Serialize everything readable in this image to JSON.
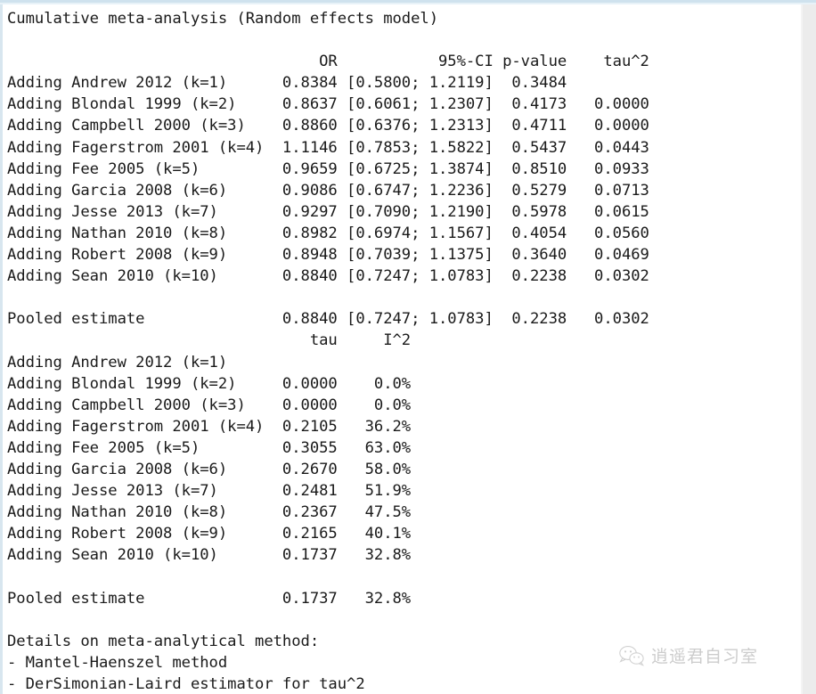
{
  "window": {
    "title": "Cumulative meta-analysis (Random effects model)",
    "accent_border_color": "#cfe2ee",
    "text_color": "#1a1a1a",
    "background_color": "#ffffff"
  },
  "table1": {
    "headers": [
      "",
      "OR",
      "95%-CI",
      "p-value",
      "tau^2"
    ],
    "rows": [
      {
        "label": "Adding Andrew 2012 (k=1)",
        "or": "0.8384",
        "ci": "[0.5800; 1.2119]",
        "p": "0.3484",
        "tau2": ""
      },
      {
        "label": "Adding Blondal 1999 (k=2)",
        "or": "0.8637",
        "ci": "[0.6061; 1.2307]",
        "p": "0.4173",
        "tau2": "0.0000"
      },
      {
        "label": "Adding Campbell 2000 (k=3)",
        "or": "0.8860",
        "ci": "[0.6376; 1.2313]",
        "p": "0.4711",
        "tau2": "0.0000"
      },
      {
        "label": "Adding Fagerstrom 2001 (k=4)",
        "or": "1.1146",
        "ci": "[0.7853; 1.5822]",
        "p": "0.5437",
        "tau2": "0.0443"
      },
      {
        "label": "Adding Fee 2005 (k=5)",
        "or": "0.9659",
        "ci": "[0.6725; 1.3874]",
        "p": "0.8510",
        "tau2": "0.0933"
      },
      {
        "label": "Adding Garcia 2008 (k=6)",
        "or": "0.9086",
        "ci": "[0.6747; 1.2236]",
        "p": "0.5279",
        "tau2": "0.0713"
      },
      {
        "label": "Adding Jesse 2013 (k=7)",
        "or": "0.9297",
        "ci": "[0.7090; 1.2190]",
        "p": "0.5978",
        "tau2": "0.0615"
      },
      {
        "label": "Adding Nathan 2010 (k=8)",
        "or": "0.8982",
        "ci": "[0.6974; 1.1567]",
        "p": "0.4054",
        "tau2": "0.0560"
      },
      {
        "label": "Adding Robert 2008 (k=9)",
        "or": "0.8948",
        "ci": "[0.7039; 1.1375]",
        "p": "0.3640",
        "tau2": "0.0469"
      },
      {
        "label": "Adding Sean 2010 (k=10)",
        "or": "0.8840",
        "ci": "[0.7247; 1.0783]",
        "p": "0.2238",
        "tau2": "0.0302"
      }
    ],
    "pooled": {
      "label": "Pooled estimate",
      "or": "0.8840",
      "ci": "[0.7247; 1.0783]",
      "p": "0.2238",
      "tau2": "0.0302"
    }
  },
  "table2": {
    "headers": [
      "",
      "tau",
      "I^2"
    ],
    "rows": [
      {
        "label": "Adding Andrew 2012 (k=1)",
        "tau": "",
        "i2": ""
      },
      {
        "label": "Adding Blondal 1999 (k=2)",
        "tau": "0.0000",
        "i2": "0.0%"
      },
      {
        "label": "Adding Campbell 2000 (k=3)",
        "tau": "0.0000",
        "i2": "0.0%"
      },
      {
        "label": "Adding Fagerstrom 2001 (k=4)",
        "tau": "0.2105",
        "i2": "36.2%"
      },
      {
        "label": "Adding Fee 2005 (k=5)",
        "tau": "0.3055",
        "i2": "63.0%"
      },
      {
        "label": "Adding Garcia 2008 (k=6)",
        "tau": "0.2670",
        "i2": "58.0%"
      },
      {
        "label": "Adding Jesse 2013 (k=7)",
        "tau": "0.2481",
        "i2": "51.9%"
      },
      {
        "label": "Adding Nathan 2010 (k=8)",
        "tau": "0.2367",
        "i2": "47.5%"
      },
      {
        "label": "Adding Robert 2008 (k=9)",
        "tau": "0.2165",
        "i2": "40.1%"
      },
      {
        "label": "Adding Sean 2010 (k=10)",
        "tau": "0.1737",
        "i2": "32.8%"
      }
    ],
    "pooled": {
      "label": "Pooled estimate",
      "tau": "0.1737",
      "i2": "32.8%"
    }
  },
  "details": {
    "heading": "Details on meta-analytical method:",
    "bullets": [
      "- Mantel-Haenszel method",
      "- DerSimonian-Laird estimator for tau^2"
    ]
  },
  "watermark": {
    "icon": "wechat-icon",
    "text": "逍遥君自习室"
  },
  "console_text": "Cumulative meta-analysis (Random effects model)\n\n                                  OR           95%-CI p-value    tau^2\nAdding Andrew 2012 (k=1)      0.8384 [0.5800; 1.2119]  0.3484\nAdding Blondal 1999 (k=2)     0.8637 [0.6061; 1.2307]  0.4173   0.0000\nAdding Campbell 2000 (k=3)    0.8860 [0.6376; 1.2313]  0.4711   0.0000\nAdding Fagerstrom 2001 (k=4)  1.1146 [0.7853; 1.5822]  0.5437   0.0443\nAdding Fee 2005 (k=5)         0.9659 [0.6725; 1.3874]  0.8510   0.0933\nAdding Garcia 2008 (k=6)      0.9086 [0.6747; 1.2236]  0.5279   0.0713\nAdding Jesse 2013 (k=7)       0.9297 [0.7090; 1.2190]  0.5978   0.0615\nAdding Nathan 2010 (k=8)      0.8982 [0.6974; 1.1567]  0.4054   0.0560\nAdding Robert 2008 (k=9)      0.8948 [0.7039; 1.1375]  0.3640   0.0469\nAdding Sean 2010 (k=10)       0.8840 [0.7247; 1.0783]  0.2238   0.0302\n\nPooled estimate               0.8840 [0.7247; 1.0783]  0.2238   0.0302\n                                 tau     I^2\nAdding Andrew 2012 (k=1)\nAdding Blondal 1999 (k=2)     0.0000    0.0%\nAdding Campbell 2000 (k=3)    0.0000    0.0%\nAdding Fagerstrom 2001 (k=4)  0.2105   36.2%\nAdding Fee 2005 (k=5)         0.3055   63.0%\nAdding Garcia 2008 (k=6)      0.2670   58.0%\nAdding Jesse 2013 (k=7)       0.2481   51.9%\nAdding Nathan 2010 (k=8)      0.2367   47.5%\nAdding Robert 2008 (k=9)      0.2165   40.1%\nAdding Sean 2010 (k=10)       0.1737   32.8%\n\nPooled estimate               0.1737   32.8%\n\nDetails on meta-analytical method:\n- Mantel-Haenszel method\n- DerSimonian-Laird estimator for tau^2"
}
